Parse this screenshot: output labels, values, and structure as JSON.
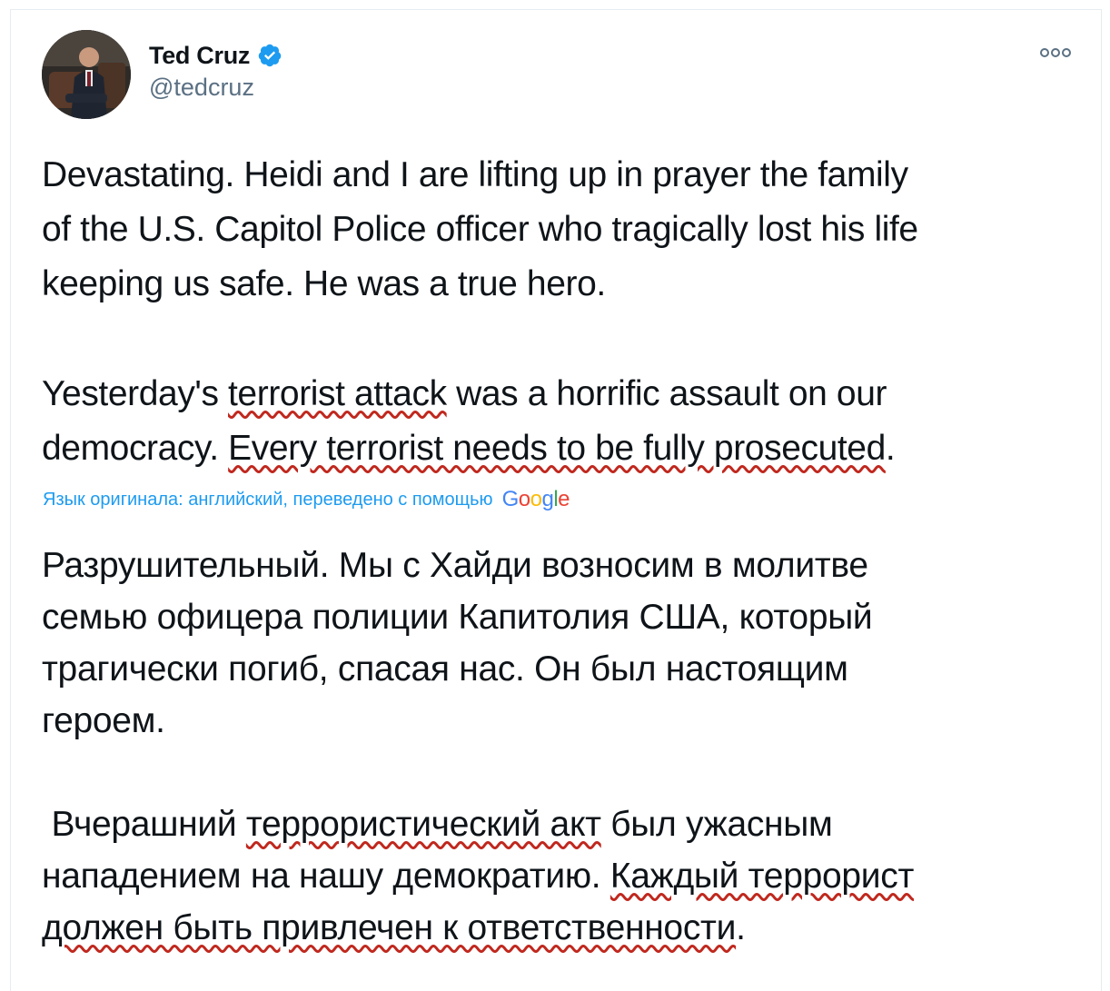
{
  "author": {
    "display_name": "Ted Cruz",
    "handle": "@tedcruz",
    "verified_color": "#1d9bf0"
  },
  "menu": {
    "more_icon": "more-horizontal-icon"
  },
  "tweet": {
    "para1": [
      "Devastating. Heidi and I are lifting up in prayer the family",
      "of the U.S. Capitol Police officer who tragically lost his life",
      "keeping us safe. He was a true hero."
    ],
    "para2": {
      "line1_pre": "Yesterday's",
      "line1_mark": "terrorist attack",
      "line1_post": " was a horrific assault on our",
      "line2_pre": "democracy. ",
      "line2_mark": "Every terrorist needs to be fully prosecuted",
      "line2_post": "."
    }
  },
  "translation": {
    "note": "Язык оригинала: английский, переведено с помощью",
    "provider": "Google",
    "para1": [
      "Разрушительный. Мы с Хайди возносим в молитве",
      "семью офицера полиции Капитолия США, который",
      "трагически погиб, спасая нас. Он был настоящим",
      "героем."
    ],
    "para2": {
      "line1_pre": " Вчерашний ",
      "line1_mark": "террористический акт",
      "line1_post": " был ужасным",
      "line2_pre": "нападением на нашу демократию. ",
      "line2_mark": "Каждый террорист",
      "line3_mark": "должен быть привлечен к ответственности",
      "line3_post": "."
    }
  },
  "colors": {
    "underline_marker": "#c0281e",
    "link": "#1d9bf0",
    "secondary_text": "#5b7083"
  }
}
